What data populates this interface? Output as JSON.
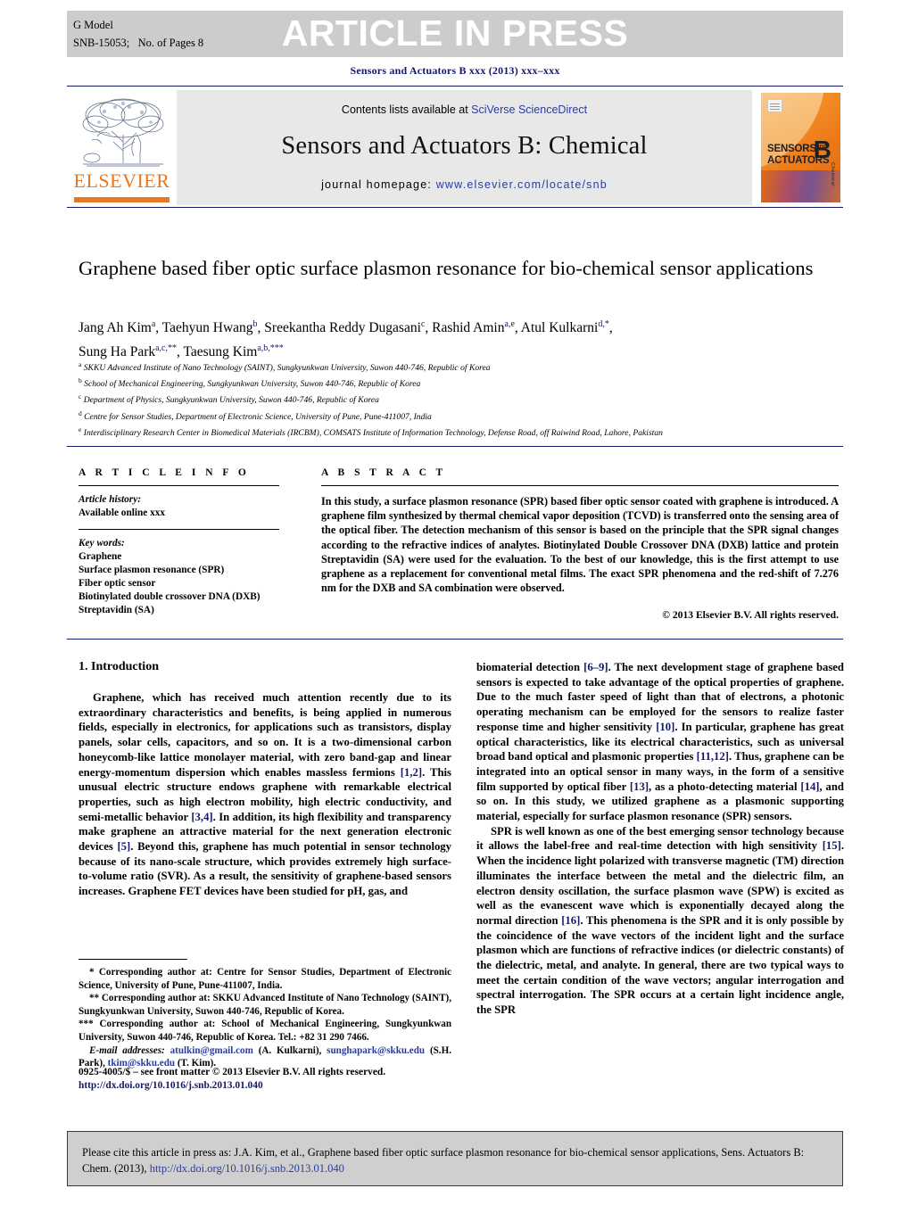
{
  "banner": {
    "article_in_press": "ARTICLE IN PRESS",
    "g_model": "G Model",
    "model_id": "SNB-15053;   No. of Pages 8",
    "journal_ref": "Sensors and Actuators B xxx (2013) xxx–xxx"
  },
  "masthead": {
    "contents_prefix": "Contents lists available at ",
    "contents_link": "SciVerse ScienceDirect",
    "journal_name": "Sensors and Actuators B: Chemical",
    "homepage_prefix": "journal homepage: ",
    "homepage_url": "www.elsevier.com/locate/snb",
    "publisher": "ELSEVIER",
    "cover": {
      "line1": "SENSORS",
      "line1_small": "and",
      "line2": "ACTUATORS",
      "letter": "B",
      "chemical": "Chemical"
    }
  },
  "article": {
    "title": "Graphene based fiber optic surface plasmon resonance for bio-chemical sensor applications",
    "authors_line1": "Jang Ah Kim a, Taehyun Hwang b, Sreekantha Reddy Dugasani c, Rashid Amin a,e, Atul Kulkarni d,*,",
    "authors_line2": "Sung Ha Park a,c,**, Taesung Kim a,b,***",
    "affiliations": [
      {
        "mark": "a",
        "text": "SKKU Advanced Institute of Nano Technology (SAINT), Sungkyunkwan University, Suwon 440-746, Republic of Korea"
      },
      {
        "mark": "b",
        "text": "School of Mechanical Engineering, Sungkyunkwan University, Suwon 440-746, Republic of Korea"
      },
      {
        "mark": "c",
        "text": "Department of Physics, Sungkyunkwan University, Suwon 440-746, Republic of Korea"
      },
      {
        "mark": "d",
        "text": "Centre for Sensor Studies, Department of Electronic Science, University of Pune, Pune-411007, India"
      },
      {
        "mark": "e",
        "text": "Interdisciplinary Research Center in Biomedical Materials (IRCBM), COMSATS Institute of Information Technology, Defense Road, off Raiwind Road, Lahore, Pakistan"
      }
    ]
  },
  "article_info": {
    "heading": "A R T I C L E   I N F O",
    "history_label": "Article history:",
    "history_value": "Available online xxx",
    "keywords_label": "Key words:",
    "keywords": [
      "Graphene",
      "Surface plasmon resonance (SPR)",
      "Fiber optic sensor",
      "Biotinylated double crossover DNA (DXB)",
      "Streptavidin (SA)"
    ]
  },
  "abstract": {
    "heading": "A B S T R A C T",
    "text": "In this study, a surface plasmon resonance (SPR) based fiber optic sensor coated with graphene is introduced. A graphene film synthesized by thermal chemical vapor deposition (TCVD) is transferred onto the sensing area of the optical fiber. The detection mechanism of this sensor is based on the principle that the SPR signal changes according to the refractive indices of analytes. Biotinylated Double Crossover DNA (DXB) lattice and protein Streptavidin (SA) were used for the evaluation. To the best of our knowledge, this is the first attempt to use graphene as a replacement for conventional metal films. The exact SPR phenomena and the red-shift of 7.276 nm for the DXB and SA combination were observed.",
    "copyright": "© 2013 Elsevier B.V. All rights reserved."
  },
  "body": {
    "section_heading": "1.  Introduction",
    "left_paragraph": "Graphene, which has received much attention recently due to its extraordinary characteristics and benefits, is being applied in numerous fields, especially in electronics, for applications such as transistors, display panels, solar cells, capacitors, and so on. It is a two-dimensional carbon honeycomb-like lattice monolayer material, with zero band-gap and linear energy-momentum dispersion which enables massless fermions [1,2]. This unusual electric structure endows graphene with remarkable electrical properties, such as high electron mobility, high electric conductivity, and semi-metallic behavior [3,4]. In addition, its high flexibility and transparency make graphene an attractive material for the next generation electronic devices [5]. Beyond this, graphene has much potential in sensor technology because of its nano-scale structure, which provides extremely high surface-to-volume ratio (SVR). As a result, the sensitivity of graphene-based sensors increases. Graphene FET devices have been studied for pH, gas, and",
    "right_paragraph_1": "biomaterial detection [6–9]. The next development stage of graphene based sensors is expected to take advantage of the optical properties of graphene. Due to the much faster speed of light than that of electrons, a photonic operating mechanism can be employed for the sensors to realize faster response time and higher sensitivity [10]. In particular, graphene has great optical characteristics, like its electrical characteristics, such as universal broad band optical and plasmonic properties [11,12]. Thus, graphene can be integrated into an optical sensor in many ways, in the form of a sensitive film supported by optical fiber [13], as a photo-detecting material [14], and so on. In this study, we utilized graphene as a plasmonic supporting material, especially for surface plasmon resonance (SPR) sensors.",
    "right_paragraph_2": "SPR is well known as one of the best emerging sensor technology because it allows the label-free and real-time detection with high sensitivity [15]. When the incidence light polarized with transverse magnetic (TM) direction illuminates the interface between the metal and the dielectric film, an electron density oscillation, the surface plasmon wave (SPW) is excited as well as the evanescent wave which is exponentially decayed along the normal direction [16]. This phenomena is the SPR and it is only possible by the coincidence of the wave vectors of the incident light and the surface plasmon which are functions of refractive indices (or dielectric constants) of the dielectric, metal, and analyte. In general, there are two typical ways to meet the certain condition of the wave vectors; angular interrogation and spectral interrogation. The SPR occurs at a certain light incidence angle, the SPR"
  },
  "footnotes": {
    "note1": "* Corresponding author at: Centre for Sensor Studies, Department of Electronic Science, University of Pune, Pune-411007, India.",
    "note2": "** Corresponding author at: SKKU Advanced Institute of Nano Technology (SAINT), Sungkyunkwan University, Suwon 440-746, Republic of Korea.",
    "note3": "*** Corresponding author at: School of Mechanical Engineering, Sungkyunkwan University, Suwon 440-746, Republic of Korea. Tel.: +82 31 290 7466.",
    "email_label": "E-mail addresses:",
    "email1": "atulkin@gmail.com",
    "email1_owner": " (A. Kulkarni), ",
    "email2": "sunghapark@skku.edu",
    "email2_owner": " (S.H. Park), ",
    "email3": "tkim@skku.edu",
    "email3_owner": " (T. Kim)."
  },
  "frontmatter": {
    "line1": "0925-4005/$ – see front matter © 2013 Elsevier B.V. All rights reserved.",
    "doi": "http://dx.doi.org/10.1016/j.snb.2013.01.040"
  },
  "cite_box": {
    "text_before": "Please cite this article in press as: J.A. Kim, et al., Graphene based fiber optic surface plasmon resonance for bio-chemical sensor applications, Sens. Actuators B: Chem. (2013), ",
    "link": "http://dx.doi.org/10.1016/j.snb.2013.01.040"
  }
}
